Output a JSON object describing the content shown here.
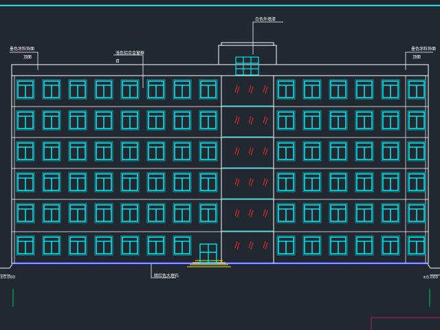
{
  "drawing": {
    "type": "building-front-elevation",
    "floors": 6,
    "colors": {
      "background": "#212830",
      "outline": "#ffffff",
      "windows": "#00e5ee",
      "ground_band": "#1d2cff",
      "entrance_steps": "#ffe100",
      "glazing_marks": "#ff2a2a",
      "grid_line": "#00c853",
      "sheet_border": "#c2185b"
    }
  },
  "annotations": {
    "roof_label": "白色外墙漆",
    "left_parapet": "墨色涂料饰面",
    "left_parapet_line2": "顶面",
    "right_parapet": "墨色涂料饰面",
    "right_parapet_line2": "顶面",
    "window_note": "浅色铝合金窗框",
    "window_note_line2": "目",
    "base_note": "暗红色大理石",
    "left_level": "±0.000",
    "right_level": "±0.000"
  }
}
